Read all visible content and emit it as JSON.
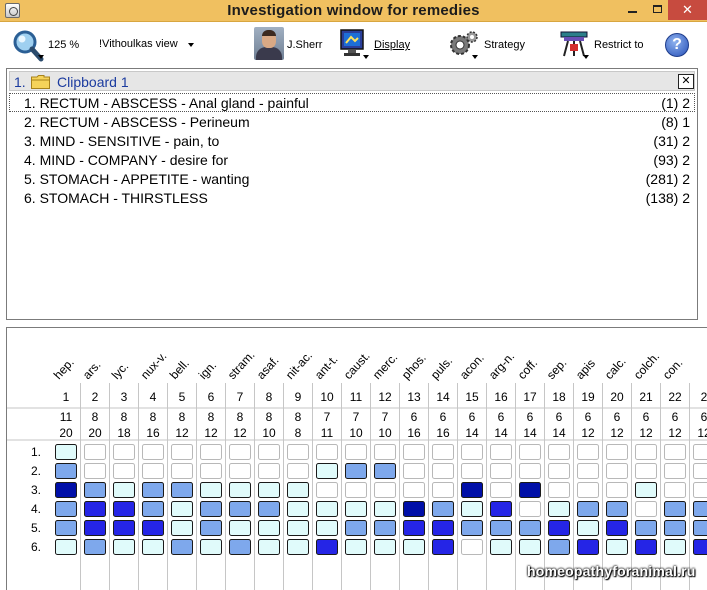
{
  "window": {
    "title": "Investigation window for remedies",
    "close_symbol": "✕",
    "colors": {
      "titlebar": "#f0c060",
      "close": "#c74b3f"
    }
  },
  "toolbar": {
    "zoom_label": "125 %",
    "view_label": "!Vithoulkas view",
    "author_label": "J.Sherr",
    "display_label": "Display",
    "strategy_label": "Strategy",
    "restrict_label": "Restrict to",
    "help_symbol": "?"
  },
  "clipboard": {
    "number": "1.",
    "title": "Clipboard 1",
    "close_symbol": "✕",
    "rubrics": [
      {
        "text": "1. RECTUM - ABSCESS - Anal gland - painful",
        "count": "(1) 2"
      },
      {
        "text": "2. RECTUM - ABSCESS - Perineum",
        "count": "(8) 1"
      },
      {
        "text": "3. MIND - SENSITIVE - pain, to",
        "count": "(31) 2"
      },
      {
        "text": "4. MIND - COMPANY - desire for",
        "count": "(93) 2"
      },
      {
        "text": "5. STOMACH - APPETITE - wanting",
        "count": "(281) 2"
      },
      {
        "text": "6. STOMACH - THIRSTLESS",
        "count": "(138) 2"
      }
    ]
  },
  "grid": {
    "remedies": [
      "hep.",
      "ars.",
      "lyc.",
      "nux-v.",
      "bell.",
      "ign.",
      "stram.",
      "asaf.",
      "nit-ac.",
      "ant-t.",
      "caust.",
      "merc.",
      "phos.",
      "puls.",
      "acon.",
      "arg-n.",
      "coff.",
      "sep.",
      "apis",
      "calc.",
      "colch.",
      "con.",
      ""
    ],
    "numbers": [
      "1",
      "2",
      "3",
      "4",
      "5",
      "6",
      "7",
      "8",
      "9",
      "10",
      "11",
      "12",
      "13",
      "14",
      "15",
      "16",
      "17",
      "18",
      "19",
      "20",
      "21",
      "22",
      "2"
    ],
    "symptoms_covered": [
      "11",
      "8",
      "8",
      "8",
      "8",
      "8",
      "8",
      "8",
      "8",
      "7",
      "7",
      "7",
      "6",
      "6",
      "6",
      "6",
      "6",
      "6",
      "6",
      "6",
      "6",
      "6",
      "6"
    ],
    "total_degree": [
      "20",
      "20",
      "18",
      "16",
      "12",
      "12",
      "12",
      "10",
      "8",
      "11",
      "10",
      "10",
      "16",
      "16",
      "14",
      "14",
      "14",
      "14",
      "12",
      "12",
      "12",
      "12",
      "12"
    ],
    "row_labels": [
      "1.",
      "2.",
      "3.",
      "4.",
      "5.",
      "6."
    ],
    "cells": [
      [
        1,
        0,
        0,
        0,
        0,
        0,
        0,
        0,
        0,
        0,
        0,
        0,
        0,
        0,
        0,
        0,
        0,
        0,
        0,
        0,
        0,
        0,
        0
      ],
      [
        2,
        0,
        0,
        0,
        0,
        0,
        0,
        0,
        0,
        1,
        2,
        2,
        0,
        0,
        0,
        0,
        0,
        0,
        0,
        0,
        0,
        0,
        0
      ],
      [
        4,
        2,
        1,
        2,
        2,
        1,
        1,
        1,
        1,
        0,
        0,
        0,
        0,
        0,
        4,
        0,
        4,
        0,
        0,
        0,
        1,
        0,
        0
      ],
      [
        2,
        3,
        3,
        2,
        1,
        2,
        2,
        2,
        1,
        1,
        1,
        1,
        4,
        2,
        1,
        3,
        0,
        1,
        2,
        2,
        0,
        2,
        2
      ],
      [
        2,
        3,
        3,
        3,
        1,
        2,
        1,
        1,
        1,
        1,
        2,
        2,
        3,
        3,
        2,
        2,
        2,
        3,
        1,
        3,
        2,
        2,
        2
      ],
      [
        1,
        2,
        1,
        1,
        2,
        1,
        2,
        1,
        1,
        3,
        1,
        1,
        1,
        3,
        0,
        1,
        1,
        2,
        3,
        1,
        3,
        1,
        3
      ]
    ],
    "palette": {
      "empty_fill": "#ffffff",
      "empty_stroke": "#b8b8b8",
      "grade1": "#e0fbfb",
      "grade2": "#7ea8ec",
      "grade3": "#2525e6",
      "grade4": "#000fa8",
      "cell_stroke": "#1a1a1a"
    }
  },
  "watermark": "homeopathyforanimal.ru"
}
